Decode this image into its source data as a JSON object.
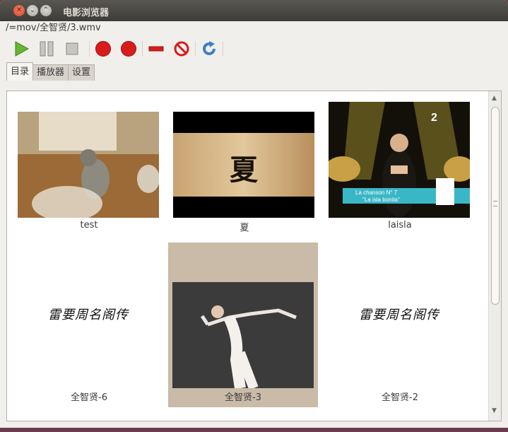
{
  "window": {
    "title": "电影浏览器",
    "buttons": {
      "close": "✕",
      "minimize": "⌄",
      "maximize": "⌃"
    }
  },
  "path": "/=mov/全智贤/3.wmv",
  "toolbar": {
    "icons": [
      "play-icon",
      "pause-icon",
      "stop-icon",
      "record-icon",
      "record-icon",
      "remove-icon",
      "block-icon",
      "refresh-icon"
    ]
  },
  "tabs": [
    {
      "label": "目录",
      "active": true
    },
    {
      "label": "播放器",
      "active": false
    },
    {
      "label": "设置",
      "active": false
    }
  ],
  "grid": {
    "items": [
      {
        "label": "test",
        "thumb": "cat-video-thumbnail"
      },
      {
        "label": "夏",
        "thumb": "calligraphy-video-thumbnail",
        "thumb_text": "夏"
      },
      {
        "label": "laisla",
        "thumb": "concert-video-thumbnail",
        "thumb_text": "La chanson N° 7",
        "thumb_text2": "\"La isla bonita\""
      },
      {
        "label": "全智贤-6",
        "thumb": "signature-image",
        "signature": "雷要周名阁传"
      },
      {
        "label": "全智贤-3",
        "thumb": "dancer-video-thumbnail",
        "selected": true
      },
      {
        "label": "全智贤-2",
        "thumb": "signature-image",
        "signature": "雷要周名阁传"
      }
    ]
  },
  "scrollbar": {
    "up": "▲",
    "down": "▼"
  },
  "colors": {
    "accent_record": "#d41c1c",
    "play": "#5aa827",
    "selected_bg": "#c9bba8"
  }
}
